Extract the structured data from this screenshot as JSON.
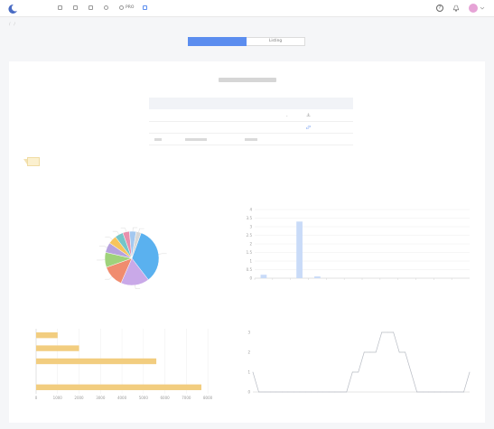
{
  "brand": {
    "name": ""
  },
  "nav": {
    "items": [
      {
        "label": "",
        "active": false
      },
      {
        "label": "",
        "active": false
      },
      {
        "label": "",
        "active": false
      },
      {
        "label": "",
        "active": false
      },
      {
        "label": "PRO",
        "active": false
      },
      {
        "label": "",
        "active": true
      }
    ]
  },
  "header": {
    "help_icon": "help-icon",
    "bell_icon": "bell-icon",
    "avatar_text": ""
  },
  "breadcrumb": [
    "",
    "",
    ""
  ],
  "tabs": [
    {
      "label": "",
      "active": true
    },
    {
      "label": "Listing",
      "active": false
    }
  ],
  "report": {
    "title_suffix": "",
    "summary": {
      "header": [
        "",
        "",
        "",
        ""
      ],
      "rows": [
        {
          "label": "",
          "value": "",
          "label2": "",
          "num": "-",
          "action": "",
          "action_icon": "download-icon"
        },
        {
          "label": "",
          "value": "",
          "label2": "",
          "num": "",
          "action": "",
          "action_icon": "link-icon"
        }
      ]
    }
  },
  "section_tag": "",
  "colors": {
    "accent": "#5b8def",
    "bar_fill": "#f2cd7f",
    "column_fill": "#c9dbf8",
    "line": "#b8bcc4",
    "pie": [
      "#5ab1ef",
      "#c9a9e8",
      "#f08c6f",
      "#9fd27b",
      "#b6a2de",
      "#f7c45c",
      "#74c5c9",
      "#e890ac",
      "#a3c8f0",
      "#d7d7d7"
    ]
  },
  "chart_data": [
    {
      "type": "pie",
      "title": "",
      "values": [
        34,
        17,
        13,
        9,
        6,
        5,
        5,
        4,
        4,
        3
      ],
      "labels": [
        "",
        "",
        "",
        "",
        "",
        "",
        "",
        "",
        "",
        ""
      ],
      "grid": false
    },
    {
      "type": "bar",
      "title": "",
      "orientation": "vertical",
      "categories": [
        "",
        "",
        "",
        "",
        "",
        "",
        "",
        "",
        "",
        "",
        "",
        ""
      ],
      "values": [
        0.2,
        0,
        3.3,
        0.1,
        0,
        0,
        0,
        0,
        0,
        0,
        0,
        0
      ],
      "ylim": [
        0,
        4
      ],
      "yticks": [
        "0",
        "0.5",
        "1",
        "1.5",
        "2",
        "2.5",
        "3",
        "3.5",
        "4"
      ],
      "grid": true
    },
    {
      "type": "bar",
      "title": "",
      "orientation": "horizontal",
      "categories": [
        "",
        "",
        "",
        "",
        ""
      ],
      "values": [
        1000,
        2000,
        5600,
        0,
        7700
      ],
      "xlim": [
        0,
        8500
      ],
      "xticks": [
        "0",
        "1000",
        "2000",
        "3000",
        "4000",
        "5000",
        "6000",
        "7000",
        "8000"
      ],
      "grid": true
    },
    {
      "type": "line",
      "title": "",
      "x": [
        "",
        "",
        "",
        "",
        "",
        "",
        "",
        "",
        "",
        "",
        "",
        "",
        "",
        "",
        "",
        "",
        "",
        "",
        "",
        "",
        "",
        "",
        "",
        "",
        "",
        "",
        "",
        "",
        "",
        "",
        "",
        "",
        "",
        "",
        "",
        "",
        "",
        ""
      ],
      "values": [
        1,
        0,
        0,
        0,
        0,
        0,
        0,
        0,
        0,
        0,
        0,
        0,
        0,
        0,
        0,
        0,
        0,
        1,
        1,
        2,
        2,
        2,
        3,
        3,
        3,
        2,
        2,
        1,
        0,
        0,
        0,
        0,
        0,
        0,
        0,
        0,
        0,
        1
      ],
      "ylim": [
        0,
        3
      ],
      "yticks": [
        "0",
        "1",
        "2",
        "3"
      ],
      "grid": false
    }
  ]
}
